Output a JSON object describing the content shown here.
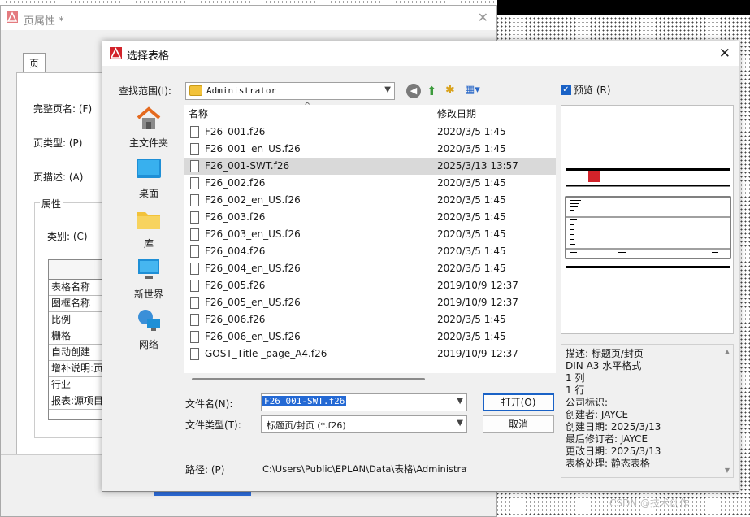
{
  "back_dialog": {
    "title": "页属性 *",
    "tab": "页",
    "fields": {
      "full_page_name": "完整页名: (F)",
      "page_type": "页类型: (P)",
      "page_desc": "页描述: (A)",
      "group": "属性",
      "category": "类别: (C)"
    },
    "grid_rows": [
      "表格名称",
      "图框名称",
      "比例",
      "栅格",
      "自动创建",
      "增补说明:页",
      "行业",
      "报表:源项目"
    ]
  },
  "dialog": {
    "title": "选择表格",
    "look_in_label": "查找范围(I):",
    "look_in_value": "Administrator",
    "places": [
      {
        "label": "主文件夹",
        "icon": "home-icon"
      },
      {
        "label": "桌面",
        "icon": "desktop-icon"
      },
      {
        "label": "库",
        "icon": "library-icon"
      },
      {
        "label": "新世界",
        "icon": "computer-icon"
      },
      {
        "label": "网络",
        "icon": "network-icon"
      }
    ],
    "columns": {
      "name": "名称",
      "date": "修改日期"
    },
    "files": [
      {
        "name": "F26_001.f26",
        "date": "2020/3/5 1:45"
      },
      {
        "name": "F26_001_en_US.f26",
        "date": "2020/3/5 1:45"
      },
      {
        "name": "F26_001-SWT.f26",
        "date": "2025/3/13 13:57"
      },
      {
        "name": "F26_002.f26",
        "date": "2020/3/5 1:45"
      },
      {
        "name": "F26_002_en_US.f26",
        "date": "2020/3/5 1:45"
      },
      {
        "name": "F26_003.f26",
        "date": "2020/3/5 1:45"
      },
      {
        "name": "F26_003_en_US.f26",
        "date": "2020/3/5 1:45"
      },
      {
        "name": "F26_004.f26",
        "date": "2020/3/5 1:45"
      },
      {
        "name": "F26_004_en_US.f26",
        "date": "2020/3/5 1:45"
      },
      {
        "name": "F26_005.f26",
        "date": "2019/10/9 12:37"
      },
      {
        "name": "F26_005_en_US.f26",
        "date": "2019/10/9 12:37"
      },
      {
        "name": "F26_006.f26",
        "date": "2020/3/5 1:45"
      },
      {
        "name": "F26_006_en_US.f26",
        "date": "2020/3/5 1:45"
      },
      {
        "name": "GOST_Title _page_A4.f26",
        "date": "2019/10/9 12:37"
      }
    ],
    "selected_index": 2,
    "preview_label": "预览 (R)",
    "preview_checked": true,
    "description_lines": [
      "描述: 标题页/封页",
      "DIN A3 水平格式",
      "1 列",
      "1 行",
      "公司标识:",
      "创建者: JAYCE",
      "创建日期: 2025/3/13",
      "最后修订者: JAYCE",
      "更改日期: 2025/3/13",
      "表格处理: 静态表格"
    ],
    "filename_label": "文件名(N):",
    "filename_value": "F26_001-SWT.f26",
    "filetype_label": "文件类型(T):",
    "filetype_value": "标题页/封页 (*.f26)",
    "open_button": "打开(O)",
    "cancel_button": "取消",
    "path_label": "路径: (P)",
    "path_value": "C:\\Users\\Public\\EPLAN\\Data\\表格\\Administrat"
  },
  "watermark": "CSDN @技术创作",
  "colors": {
    "accent": "#1a62c6",
    "selected_row": "#d9d9d9",
    "eplan_red": "#d2232a"
  }
}
